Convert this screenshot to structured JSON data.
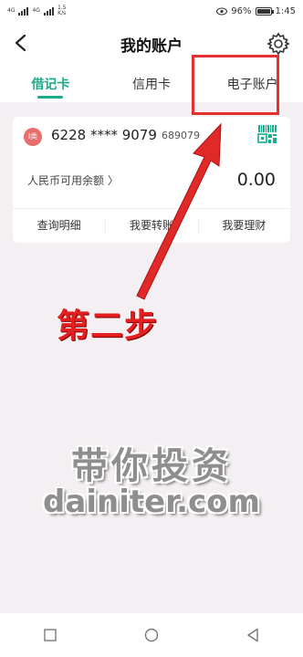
{
  "status_bar": {
    "signal1_label": "4G",
    "signal2_label": "4G",
    "net_speed_value": "1.5",
    "net_speed_unit": "K/s",
    "battery": "96%",
    "time": "1:45"
  },
  "header": {
    "title": "我的账户"
  },
  "tabs": [
    {
      "label": "借记卡"
    },
    {
      "label": "信用卡"
    },
    {
      "label": "电子账户"
    }
  ],
  "card": {
    "badge": "I类",
    "account_number": "6228 **** 9079",
    "account_sub": "689079",
    "balance_label": "人民币可用余额 〉",
    "balance_value": "0.00",
    "actions": [
      {
        "label": "查询明细"
      },
      {
        "label": "我要转账"
      },
      {
        "label": "我要理财"
      }
    ]
  },
  "annotation": {
    "step": "第二步"
  },
  "watermark": {
    "line1": "带你投资",
    "line2": "dainiter.com"
  },
  "colors": {
    "accent": "#1aab8a",
    "highlight": "#e53030",
    "background": "#f4eff2"
  }
}
